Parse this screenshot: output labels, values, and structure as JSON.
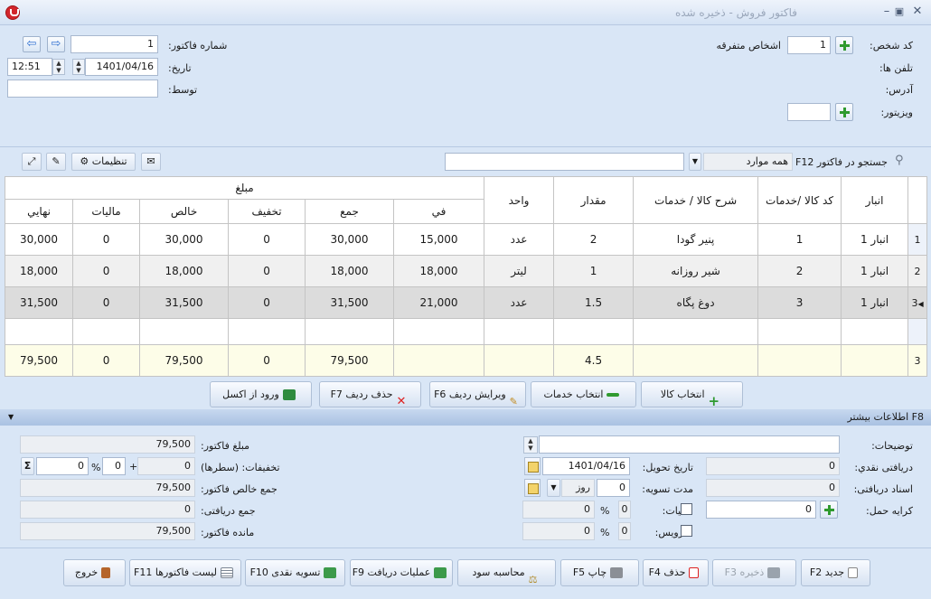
{
  "window": {
    "title": "فاکتور فروش - ذخیره شده"
  },
  "header": {
    "person_code_label": "کد شخص:",
    "person_code": "1",
    "person_name": "اشخاص متفرقه",
    "phones_label": "تلفن ها:",
    "address_label": "آدرس:",
    "visitor_label": "ویزیتور:",
    "invoice_no_label": "شماره فاکتور:",
    "invoice_no": "1",
    "date_label": "تاریخ:",
    "date": "1401/04/16",
    "time": "12:51",
    "by_label": "توسط:"
  },
  "toolbar": {
    "search_label": "جستجو در فاکتور F12",
    "search_scope": "همه موارد",
    "settings_label": "تنظیمات"
  },
  "grid": {
    "headers": {
      "warehouse": "انبار",
      "code": "کد کالا /خدمات",
      "desc": "شرح کالا / خدمات",
      "qty": "مقدار",
      "unit": "واحد",
      "amount_group": "مبلغ",
      "unit_price": "في",
      "sum": "جمع",
      "discount": "تخفيف",
      "net": "خالص",
      "tax": "ماليات",
      "final": "نهايي"
    },
    "rows": [
      {
        "num": "1",
        "warehouse": "انبار 1",
        "code": "1",
        "desc": "پنیر گودا",
        "qty": "2",
        "unit": "عدد",
        "unit_price": "15,000",
        "sum": "30,000",
        "discount": "0",
        "net": "30,000",
        "tax": "0",
        "final": "30,000"
      },
      {
        "num": "2",
        "warehouse": "انبار 1",
        "code": "2",
        "desc": "شیر روزانه",
        "qty": "1",
        "unit": "لیتر",
        "unit_price": "18,000",
        "sum": "18,000",
        "discount": "0",
        "net": "18,000",
        "tax": "0",
        "final": "18,000"
      },
      {
        "num": "3",
        "warehouse": "انبار 1",
        "code": "3",
        "desc": "دوغ پگاه",
        "qty": "1.5",
        "unit": "عدد",
        "unit_price": "21,000",
        "sum": "31,500",
        "discount": "0",
        "net": "31,500",
        "tax": "0",
        "final": "31,500"
      }
    ],
    "totals": {
      "num": "3",
      "qty": "4.5",
      "sum": "79,500",
      "discount": "0",
      "net": "79,500",
      "tax": "0",
      "final": "79,500"
    }
  },
  "row_buttons": {
    "select_goods": "انتخاب کالا",
    "select_services": "انتخاب خدمات",
    "edit_row": "ویرایش ردیف F6",
    "delete_row": "حذف ردیف F7",
    "import_excel": "ورود از اکسل"
  },
  "more_info": {
    "label": "F8 اطلاعات بیشتر"
  },
  "details": {
    "notes_label": "توضیحات:",
    "cash_received_label": "دریافتی نقدي:",
    "cash_received": "0",
    "delivery_date_label": "تاریخ تحویل:",
    "delivery_date": "1401/04/16",
    "docs_received_label": "اسناد دریافتی:",
    "docs_received": "0",
    "settlement_label": "مدت تسویه:",
    "settlement_value": "0",
    "settlement_unit": "روز",
    "freight_label": "کرایه حمل:",
    "freight": "0",
    "tax_label": "مالیات:",
    "tax_percent": "0",
    "tax_amount": "0",
    "service_label": "سرویس:",
    "service_percent": "0",
    "service_amount": "0",
    "percent_sign": "%",
    "invoice_amount_label": "مبلغ فاکتور:",
    "invoice_amount": "79,500",
    "discounts_label": "تخفیفات: (سطرها)",
    "discounts_rows": "0",
    "discount_percent": "0",
    "discount_extra": "0",
    "plus": "+",
    "sigma": "Σ",
    "net_total_label": "جمع خالص فاکتور:",
    "net_total": "79,500",
    "received_total_label": "جمع دریافتی:",
    "received_total": "0",
    "remaining_label": "مانده فاکتور:",
    "remaining": "79,500"
  },
  "bottom_buttons": {
    "new": "جدید F2",
    "save": "ذخیره F3",
    "delete": "حذف F4",
    "print": "چاپ F5",
    "profit": "محاسبه سود",
    "receipt_ops": "عملیات دریافت F9",
    "cash_settle": "تسویه نقدی F10",
    "invoice_list": "لیست فاکتورها F11",
    "exit": "خروج"
  },
  "colors": {
    "window_bg": "#d9e6f6",
    "accent_green": "#2f9a2f",
    "total_row": "#fdfde8",
    "selected_row": "#dcdcdc"
  }
}
